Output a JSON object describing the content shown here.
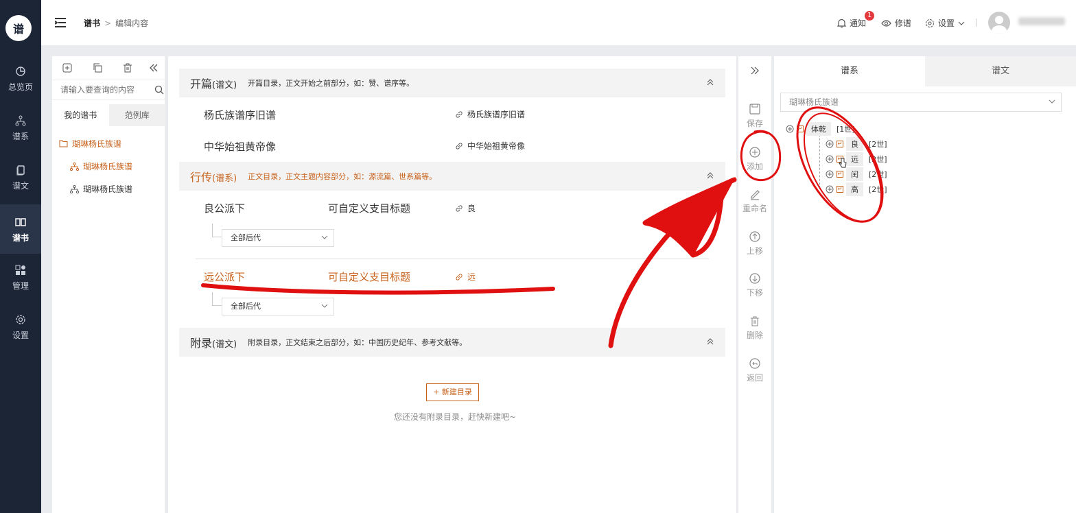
{
  "nav": {
    "items": [
      {
        "label": "总览页",
        "icon": "pie-chart-icon"
      },
      {
        "label": "谱系",
        "icon": "tree-icon"
      },
      {
        "label": "谱文",
        "icon": "document-icon"
      },
      {
        "label": "谱书",
        "icon": "book-icon",
        "active": true
      },
      {
        "label": "管理",
        "icon": "grid-icon"
      },
      {
        "label": "设置",
        "icon": "gear-icon"
      }
    ]
  },
  "header": {
    "breadcrumb_root": "谱书",
    "breadcrumb_current": "编辑内容",
    "notify_label": "通知",
    "notify_count": "1",
    "edit_label": "修谱",
    "settings_label": "设置"
  },
  "bookpanel": {
    "search_placeholder": "请输入要查询的内容",
    "tab_mine": "我的谱书",
    "tab_examples": "范例库",
    "root": "瑚琳杨氏族谱",
    "children": [
      "瑚琳杨氏族谱",
      "瑚琳杨氏族谱"
    ]
  },
  "main": {
    "sections": [
      {
        "title": "开篇",
        "type": "(谱文)",
        "desc": "开篇目录，正文开始之前部分，如：赞、谱序等。"
      },
      {
        "title": "行传",
        "type": "(谱系)",
        "desc": "正文目录，正文主题内容部分，如：源流篇、世系篇等。"
      },
      {
        "title": "附录",
        "type": "(谱文)",
        "desc": "附录目录，正文结束之后部分，如：中国历史纪年、参考文献等。"
      }
    ],
    "opening_entries": [
      {
        "name": "杨氏族谱序旧谱",
        "link": "杨氏族谱序旧谱"
      },
      {
        "name": "中华始祖黄帝像",
        "link": "中华始祖黄帝像"
      }
    ],
    "biography_entries": [
      {
        "name": "良公派下",
        "subtitle": "可自定义支目标题",
        "link": "良",
        "dropdown": "全部后代"
      },
      {
        "name": "远公派下",
        "subtitle": "可自定义支目标题",
        "link": "远",
        "dropdown": "全部后代"
      }
    ],
    "new_button": "+ 新建目录",
    "empty_text": "您还没有附录目录，赶快新建吧~"
  },
  "actions": {
    "save": "保存",
    "add": "添加",
    "rename": "重命名",
    "up": "上移",
    "down": "下移",
    "delete": "删除",
    "back": "返回"
  },
  "rpanel": {
    "tab_lineage": "谱系",
    "tab_text": "谱文",
    "select_value": "瑚琳杨氏族谱",
    "root": {
      "name": "体乾",
      "gen": "[1世]"
    },
    "children": [
      {
        "name": "良",
        "gen": "[2世]"
      },
      {
        "name": "远",
        "gen": "[2世]"
      },
      {
        "name": "闰",
        "gen": "[2世]"
      },
      {
        "name": "高",
        "gen": "[2世]"
      }
    ]
  },
  "colors": {
    "accent": "#c8611a",
    "nav_bg": "#1c2536",
    "annotation": "#e01010"
  }
}
